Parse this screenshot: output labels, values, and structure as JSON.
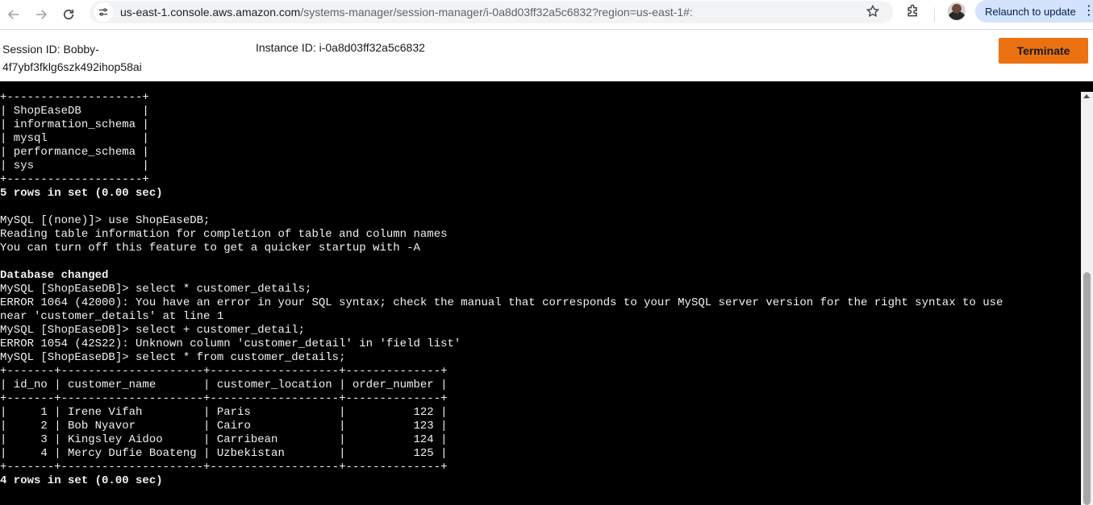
{
  "browser": {
    "url_host": "us-east-1.console.aws.amazon.com",
    "url_path": "/systems-manager/session-manager/i-0a8d03ff32a5c6832?region=us-east-1#:",
    "relaunch_label": "Relaunch to update",
    "menu_icon": "⋮"
  },
  "session": {
    "session_id": "Session ID: Bobby-4f7ybf3fklg6szk492ihop58ai",
    "instance_id": "Instance ID: i-0a8d03ff32a5c6832",
    "terminate_label": "Terminate"
  },
  "terminal": {
    "lines": [
      {
        "text": "+--------------------+",
        "bold": false
      },
      {
        "text": "| ShopEaseDB         |",
        "bold": false
      },
      {
        "text": "| information_schema |",
        "bold": false
      },
      {
        "text": "| mysql              |",
        "bold": false
      },
      {
        "text": "| performance_schema |",
        "bold": false
      },
      {
        "text": "| sys                |",
        "bold": false
      },
      {
        "text": "+--------------------+",
        "bold": false
      },
      {
        "text": "5 rows in set (0.00 sec)",
        "bold": true
      },
      {
        "text": "",
        "bold": false
      },
      {
        "text": "MySQL [(none)]> use ShopEaseDB;",
        "bold": false
      },
      {
        "text": "Reading table information for completion of table and column names",
        "bold": false
      },
      {
        "text": "You can turn off this feature to get a quicker startup with -A",
        "bold": false
      },
      {
        "text": "",
        "bold": false
      },
      {
        "text": "Database changed",
        "bold": true
      },
      {
        "text": "MySQL [ShopEaseDB]> select * customer_details;",
        "bold": false
      },
      {
        "text": "ERROR 1064 (42000): You have an error in your SQL syntax; check the manual that corresponds to your MySQL server version for the right syntax to use",
        "bold": false
      },
      {
        "text": "near 'customer_details' at line 1",
        "bold": false
      },
      {
        "text": "MySQL [ShopEaseDB]> select + customer_detail;",
        "bold": false
      },
      {
        "text": "ERROR 1054 (42S22): Unknown column 'customer_detail' in 'field list'",
        "bold": false
      },
      {
        "text": "MySQL [ShopEaseDB]> select * from customer_details;",
        "bold": false
      },
      {
        "text": "+-------+---------------------+-------------------+--------------+",
        "bold": false
      },
      {
        "text": "| id_no | customer_name       | customer_location | order_number |",
        "bold": false
      },
      {
        "text": "+-------+---------------------+-------------------+--------------+",
        "bold": false
      },
      {
        "text": "|     1 | Irene Vifah         | Paris             |          122 |",
        "bold": false
      },
      {
        "text": "|     2 | Bob Nyavor          | Cairo             |          123 |",
        "bold": false
      },
      {
        "text": "|     3 | Kingsley Aidoo      | Carribean         |          124 |",
        "bold": false
      },
      {
        "text": "|     4 | Mercy Dufie Boateng | Uzbekistan        |          125 |",
        "bold": false
      },
      {
        "text": "+-------+---------------------+-------------------+--------------+",
        "bold": false
      },
      {
        "text": "4 rows in set (0.00 sec)",
        "bold": true
      }
    ]
  }
}
